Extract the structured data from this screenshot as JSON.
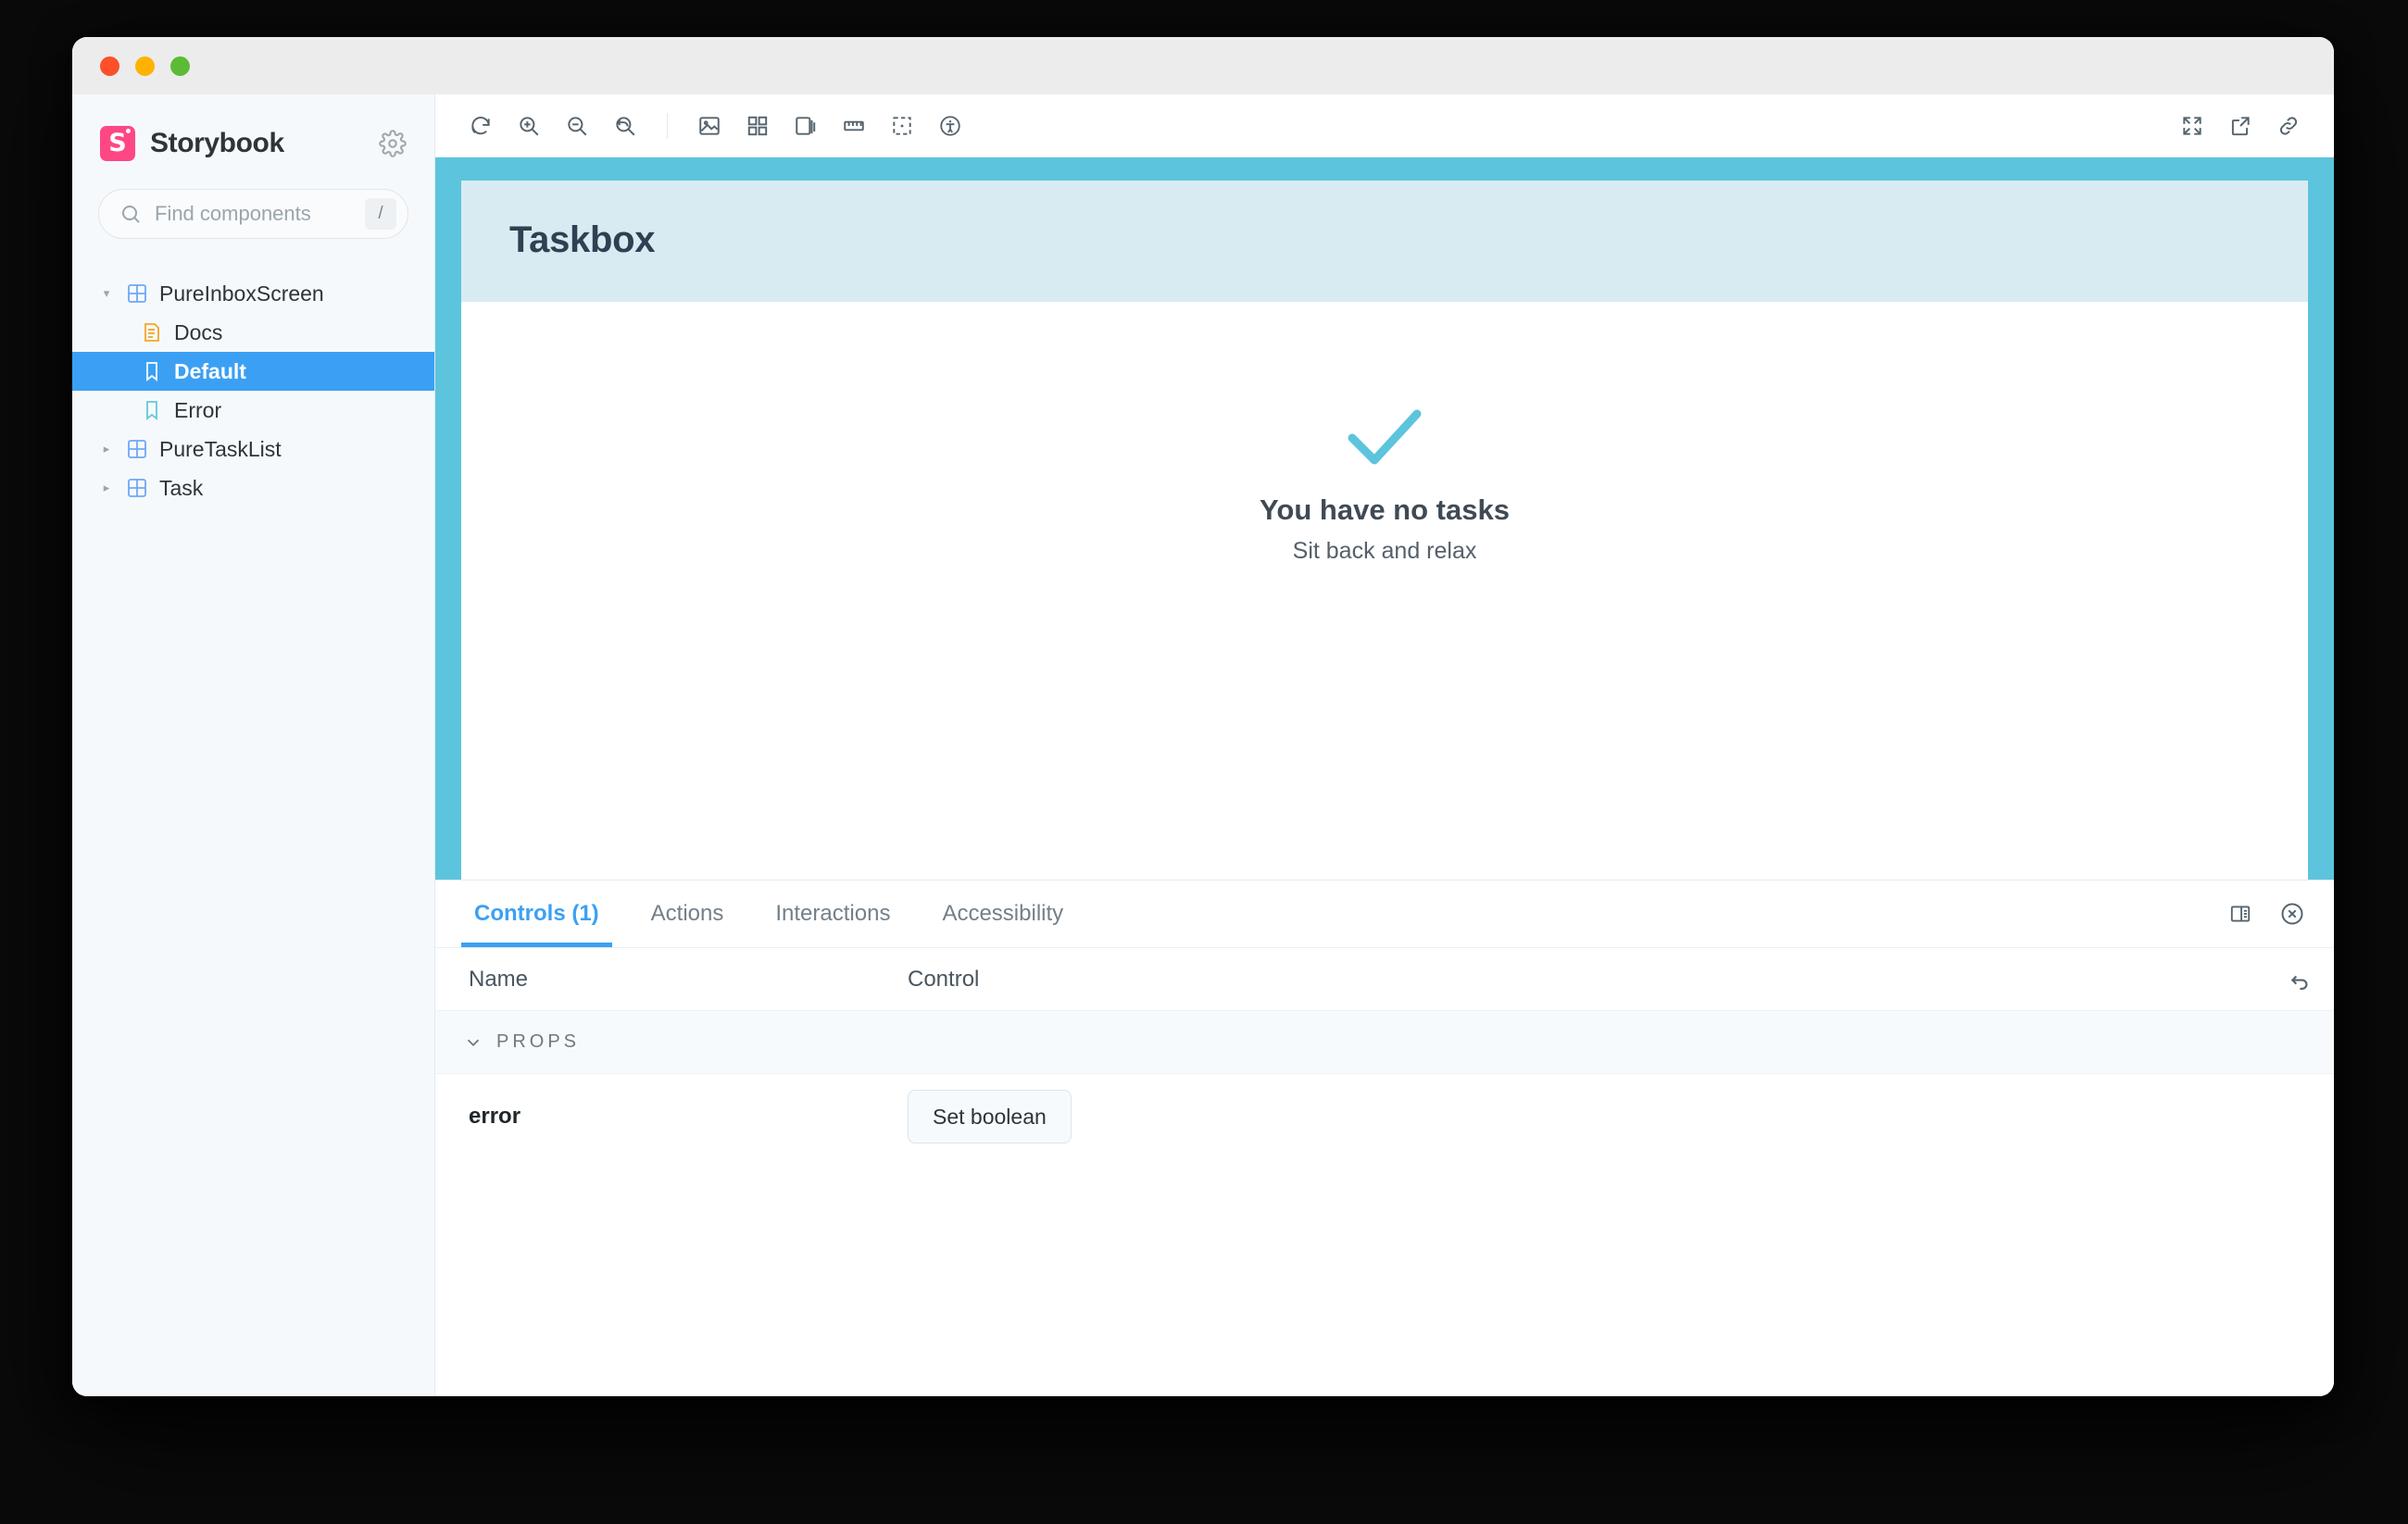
{
  "window": {
    "traffic_lights": [
      "close",
      "minimize",
      "maximize"
    ]
  },
  "sidebar": {
    "brand": "Storybook",
    "logo_color": "#FF4785",
    "settings_icon": "gear-icon",
    "search": {
      "placeholder": "Find components",
      "shortcut": "/",
      "icon": "search-icon"
    },
    "tree": [
      {
        "label": "PureInboxScreen",
        "type": "component",
        "depth": 0,
        "expanded": true,
        "selected": false
      },
      {
        "label": "Docs",
        "type": "docs",
        "depth": 1,
        "expanded": false,
        "selected": false
      },
      {
        "label": "Default",
        "type": "story",
        "depth": 1,
        "expanded": false,
        "selected": true
      },
      {
        "label": "Error",
        "type": "story",
        "depth": 1,
        "expanded": false,
        "selected": false
      },
      {
        "label": "PureTaskList",
        "type": "component",
        "depth": 0,
        "expanded": false,
        "selected": false
      },
      {
        "label": "Task",
        "type": "component",
        "depth": 0,
        "expanded": false,
        "selected": false
      }
    ]
  },
  "toolbar": {
    "left": [
      "remount-icon",
      "zoom-in-icon",
      "zoom-out-icon",
      "zoom-reset-icon",
      "backgrounds-icon",
      "grid-icon",
      "viewport-icon",
      "measure-icon",
      "outline-icon",
      "accessibility-icon"
    ],
    "right": [
      "fullscreen-icon",
      "open-new-tab-icon",
      "copy-link-icon"
    ]
  },
  "preview": {
    "border_color": "#5CC4DC",
    "header_bg": "#D9EBF2",
    "title": "Taskbox",
    "empty_state": {
      "icon": "check-icon",
      "icon_color": "#5CC4DC",
      "title": "You have no tasks",
      "subtitle": "Sit back and relax"
    }
  },
  "panel": {
    "tabs": [
      {
        "label": "Controls (1)",
        "active": true
      },
      {
        "label": "Actions",
        "active": false
      },
      {
        "label": "Interactions",
        "active": false
      },
      {
        "label": "Accessibility",
        "active": false
      }
    ],
    "accent_color": "#3BA0F4",
    "actions": [
      "panel-layout-icon",
      "close-panel-icon"
    ],
    "table": {
      "headers": {
        "name": "Name",
        "control": "Control"
      },
      "reset_icon": "reset-controls-icon",
      "groups": [
        {
          "label": "PROPS",
          "expanded": true,
          "rows": [
            {
              "name": "error",
              "control_label": "Set boolean",
              "control_type": "boolean"
            }
          ]
        }
      ]
    }
  }
}
